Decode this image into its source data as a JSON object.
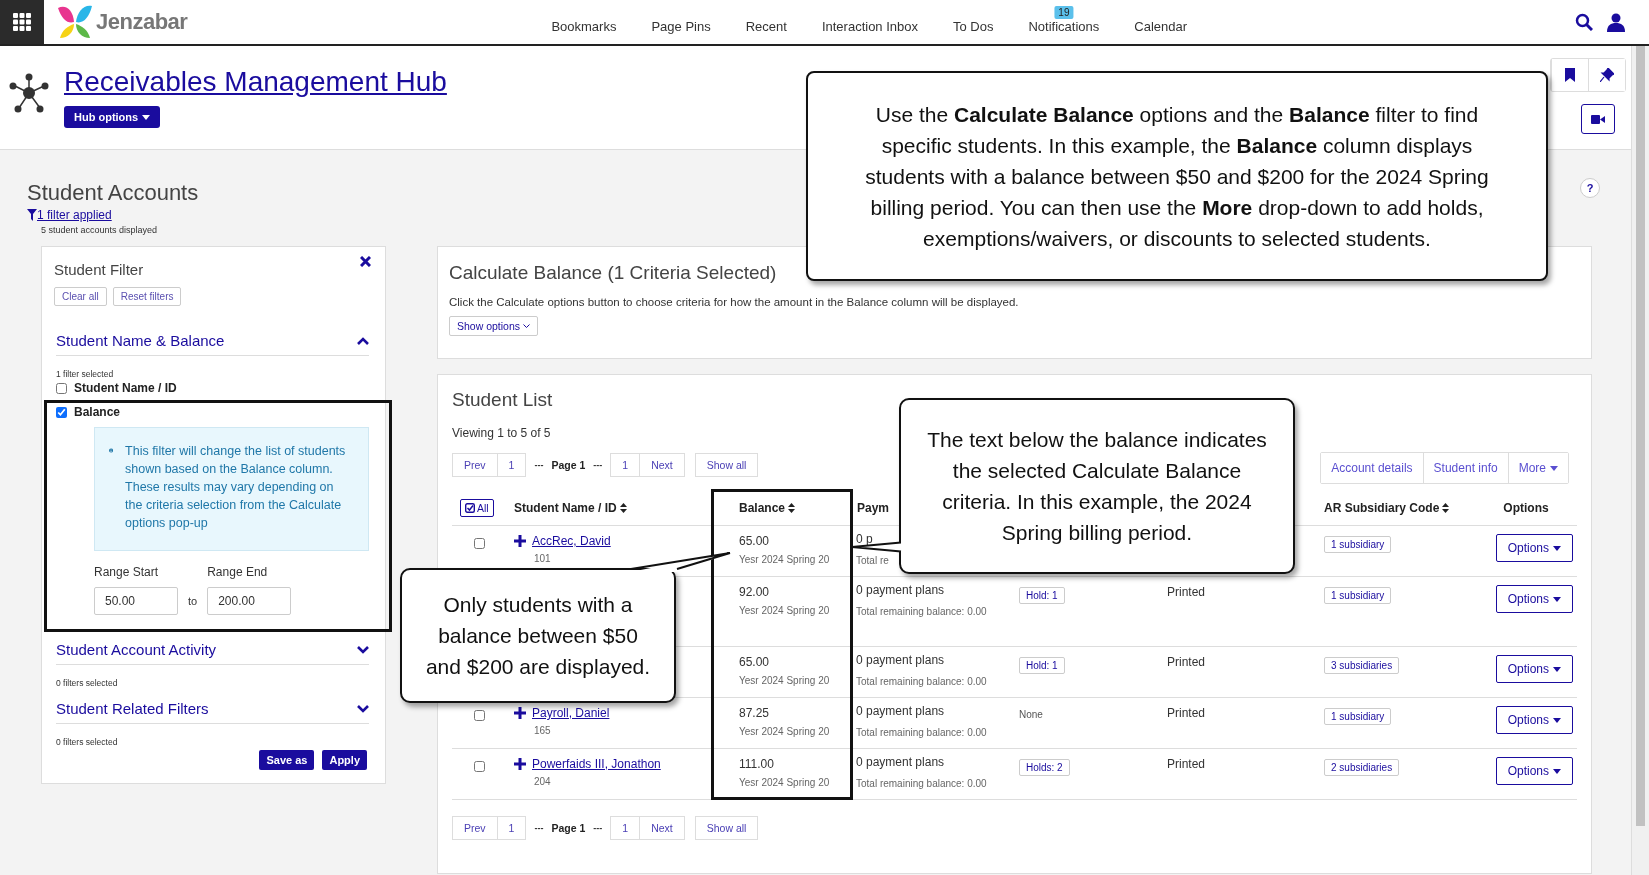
{
  "topbar": {
    "brand": "Jenzabar",
    "nav": [
      {
        "label": "Bookmarks"
      },
      {
        "label": "Page Pins"
      },
      {
        "label": "Recent"
      },
      {
        "label": "Interaction Inbox"
      },
      {
        "label": "To Dos"
      },
      {
        "label": "Notifications",
        "badge": "19"
      },
      {
        "label": "Calendar"
      }
    ]
  },
  "hub": {
    "title": "Receivables Management Hub",
    "options_button": "Hub options"
  },
  "help": "?",
  "accounts": {
    "title": "Student Accounts",
    "filter_link": "1 filter applied",
    "count": "5 student accounts displayed"
  },
  "filter_panel": {
    "title": "Student Filter",
    "buttons": [
      "Clear all",
      "Reset filters"
    ],
    "sections": [
      {
        "title": "Student Name & Balance",
        "expanded": true,
        "note": "1 filter selected",
        "filters": [
          {
            "label": "Student Name / ID",
            "checked": false
          },
          {
            "label": "Balance",
            "checked": true,
            "info": "This filter will change the list of students shown based on the Balance column. These results may vary depending on the criteria selection from the Calculate options pop-up",
            "range": {
              "start_label": "Range Start",
              "start": "50.00",
              "to": "to",
              "end_label": "Range End",
              "end": "200.00"
            }
          }
        ]
      },
      {
        "title": "Student Account Activity",
        "expanded": false,
        "note": "0 filters selected"
      },
      {
        "title": "Student Related Filters",
        "expanded": false,
        "note": "0 filters selected"
      }
    ],
    "actions": [
      "Save as",
      "Apply"
    ]
  },
  "calculate": {
    "title": "Calculate Balance (1 Criteria Selected)",
    "description": "Click the Calculate options button to choose criteria for how the amount in the Balance column will be displayed.",
    "button": "Show options"
  },
  "student_list": {
    "title": "Student List",
    "viewing": "Viewing 1 to 5 of 5",
    "pager_top": {
      "prev": "Prev",
      "first": "1",
      "dots_left": "---",
      "page": "Page 1",
      "dots_right": "---",
      "last": "1",
      "next": "Next",
      "show_all": "Show all"
    },
    "actions": [
      "Account details",
      "Student info",
      "More"
    ],
    "header": {
      "select": "All",
      "name": "Student Name / ID",
      "balance": "Balance",
      "payment": "Paym",
      "ar_code": "AR Subsidiary Code",
      "options": "Options"
    },
    "rows": [
      {
        "checked": false,
        "name": "AccRec, David",
        "id": "101",
        "balance": "65.00",
        "criteria": "Yesr 2024 Spring 20",
        "plans": "0 p",
        "total": "Total re",
        "ar": "1 subsidiary",
        "options": "Options"
      },
      {
        "balance": "92.00",
        "criteria": "Yesr 2024 Spring 20",
        "plans": "0 payment plans",
        "total": "Total remaining balance: 0.00",
        "hold": {
          "kind": "badge",
          "text": "Hold: 1"
        },
        "printed": "Printed",
        "ar": "1 subsidiary",
        "options": "Options"
      },
      {
        "balance": "65.00",
        "criteria": "Yesr 2024 Spring 20",
        "plans": "0 payment plans",
        "total": "Total remaining balance: 0.00",
        "hold": {
          "kind": "badge",
          "text": "Hold: 1"
        },
        "printed": "Printed",
        "ar": "3 subsidiaries",
        "options": "Options"
      },
      {
        "checked": false,
        "name": "Payroll, Daniel",
        "id": "165",
        "balance": "87.25",
        "criteria": "Yesr 2024 Spring 20",
        "plans": "0 payment plans",
        "total": "Total remaining balance: 0.00",
        "hold": {
          "kind": "plain",
          "text": "None"
        },
        "printed": "Printed",
        "ar": "1 subsidiary",
        "options": "Options"
      },
      {
        "checked": false,
        "name": "Powerfaids III, Jonathon",
        "id": "204",
        "balance": "111.00",
        "criteria": "Yesr 2024 Spring 20",
        "plans": "0 payment plans",
        "total": "Total remaining balance: 0.00",
        "hold": {
          "kind": "badge",
          "text": "Holds: 2"
        },
        "printed": "Printed",
        "ar": "2 subsidiaries",
        "options": "Options"
      }
    ],
    "pager_bottom": {
      "prev": "Prev",
      "first": "1",
      "dots_left": "---",
      "page": "Page 1",
      "dots_right": "---",
      "last": "1",
      "next": "Next",
      "show_all": "Show all"
    }
  },
  "callouts": [
    {
      "text": "Use the **Calculate Balance** options and the **Balance** filter to find specific students. In this example, the **Balance** column displays students with a balance between $50 and $200 for the 2024 Spring billing period. You can then use the **More** drop-down to add holds, exemptions/waivers, or discounts to selected students."
    },
    {
      "text": "The text below the balance indicates the selected Calculate Balance criteria. In this example, the 2024 Spring billing period."
    },
    {
      "text": "Only students with a balance between $50 and $200 are displayed."
    }
  ]
}
